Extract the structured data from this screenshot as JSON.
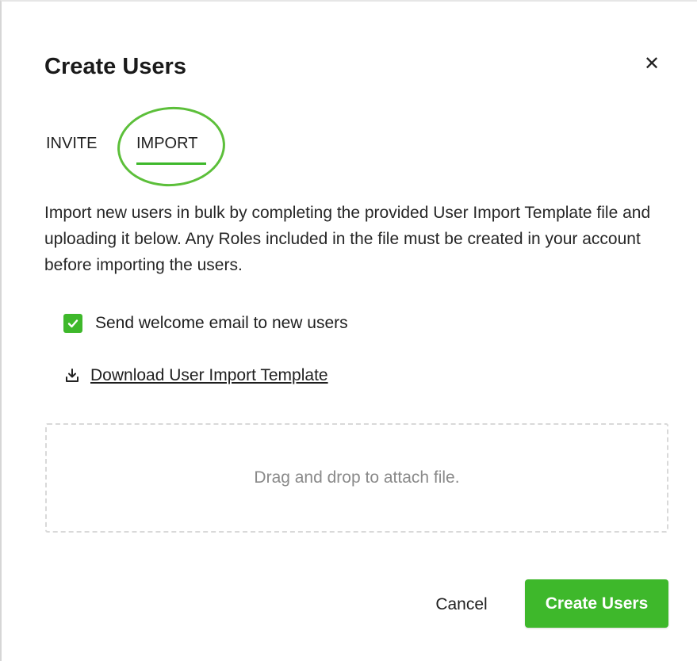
{
  "dialog": {
    "title": "Create Users",
    "close_glyph": "✕"
  },
  "tabs": [
    {
      "label": "INVITE",
      "active": false
    },
    {
      "label": "IMPORT",
      "active": true
    }
  ],
  "description": "Import new users in bulk by completing the provided User Import Template file and uploading it below. Any Roles included in the file must be created in your account before importing the users.",
  "welcome_email": {
    "label": "Send welcome email to new users",
    "checked": true
  },
  "download": {
    "icon": "download-icon",
    "label": "Download User Import Template"
  },
  "dropzone": {
    "text": "Drag and drop to attach file."
  },
  "footer": {
    "cancel_label": "Cancel",
    "create_label": "Create Users"
  },
  "colors": {
    "accent": "#3eb82b",
    "highlight_ring": "#5cbf3a",
    "text": "#1f1f1f",
    "muted": "#8a8a8a"
  }
}
